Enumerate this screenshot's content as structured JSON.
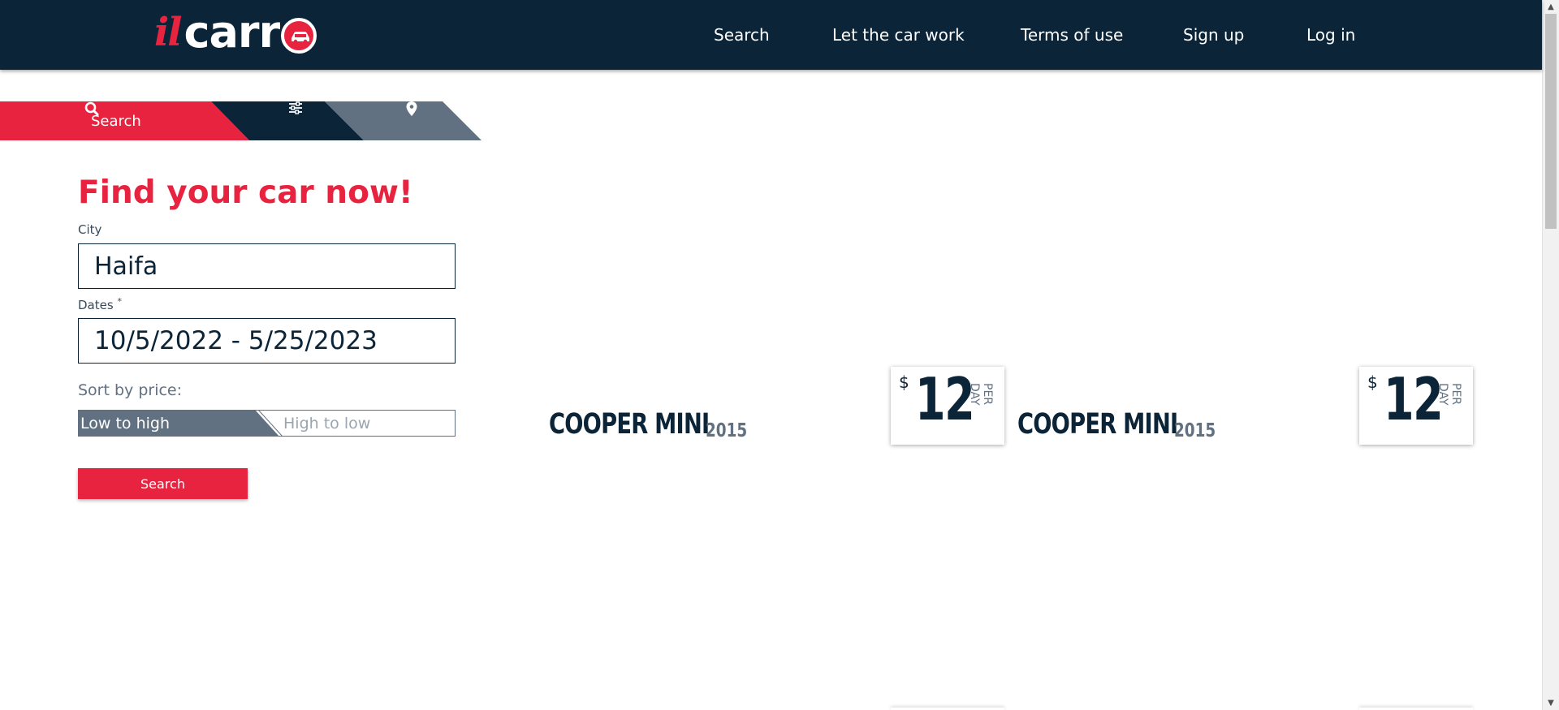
{
  "header": {
    "logo": {
      "prefix": "il",
      "word": "carr"
    },
    "nav": [
      "Search",
      "Let the car work",
      "Terms of use",
      "Sign up",
      "Log in"
    ]
  },
  "tabs": {
    "search_label": "Search",
    "filter_icon": "sliders-icon",
    "location_icon": "location-pin-icon"
  },
  "form": {
    "title": "Find your car now!",
    "city_label": "City",
    "city_value": "Haifa",
    "dates_label": "Dates",
    "dates_required_mark": "*",
    "dates_value": "10/5/2022 - 5/25/2023",
    "sort_label": "Sort by price:",
    "sort_options": [
      "Low to high",
      "High to low"
    ],
    "sort_selected": "Low to high",
    "search_button": "Search"
  },
  "cars": [
    {
      "name": "COOPER MINI",
      "year": "2015",
      "currency": "$",
      "price": "12",
      "unit": "PER DAY"
    },
    {
      "name": "COOPER MINI",
      "year": "2015",
      "currency": "$",
      "price": "12",
      "unit": "PER DAY"
    }
  ],
  "colors": {
    "navy": "#0b2438",
    "accent_red": "#e8233f",
    "slate": "#617182"
  }
}
